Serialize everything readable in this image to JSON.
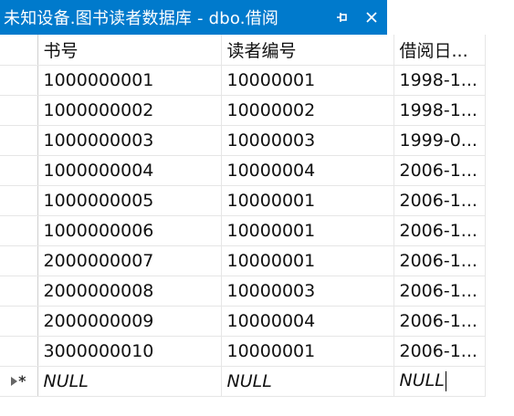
{
  "tab": {
    "title": "未知设备.图书读者数据库 - dbo.借阅",
    "pin_glyph": "⊣",
    "close_glyph": "✕",
    "accent": "#007acc"
  },
  "grid": {
    "columns": [
      "书号",
      "读者编号",
      "借阅日..."
    ],
    "rows": [
      [
        "1000000001",
        "10000001",
        "1998-1..."
      ],
      [
        "1000000002",
        "10000002",
        "1998-1..."
      ],
      [
        "1000000003",
        "10000003",
        "1999-0..."
      ],
      [
        "1000000004",
        "10000004",
        "2006-1..."
      ],
      [
        "1000000005",
        "10000001",
        "2006-1..."
      ],
      [
        "1000000006",
        "10000001",
        "2006-1..."
      ],
      [
        "2000000007",
        "10000001",
        "2006-1..."
      ],
      [
        "2000000008",
        "10000003",
        "2006-1..."
      ],
      [
        "2000000009",
        "10000004",
        "2006-1..."
      ],
      [
        "3000000010",
        "10000001",
        "2006-1..."
      ]
    ],
    "new_row": [
      "NULL",
      "NULL",
      "NULL"
    ],
    "new_row_marker": "*"
  }
}
